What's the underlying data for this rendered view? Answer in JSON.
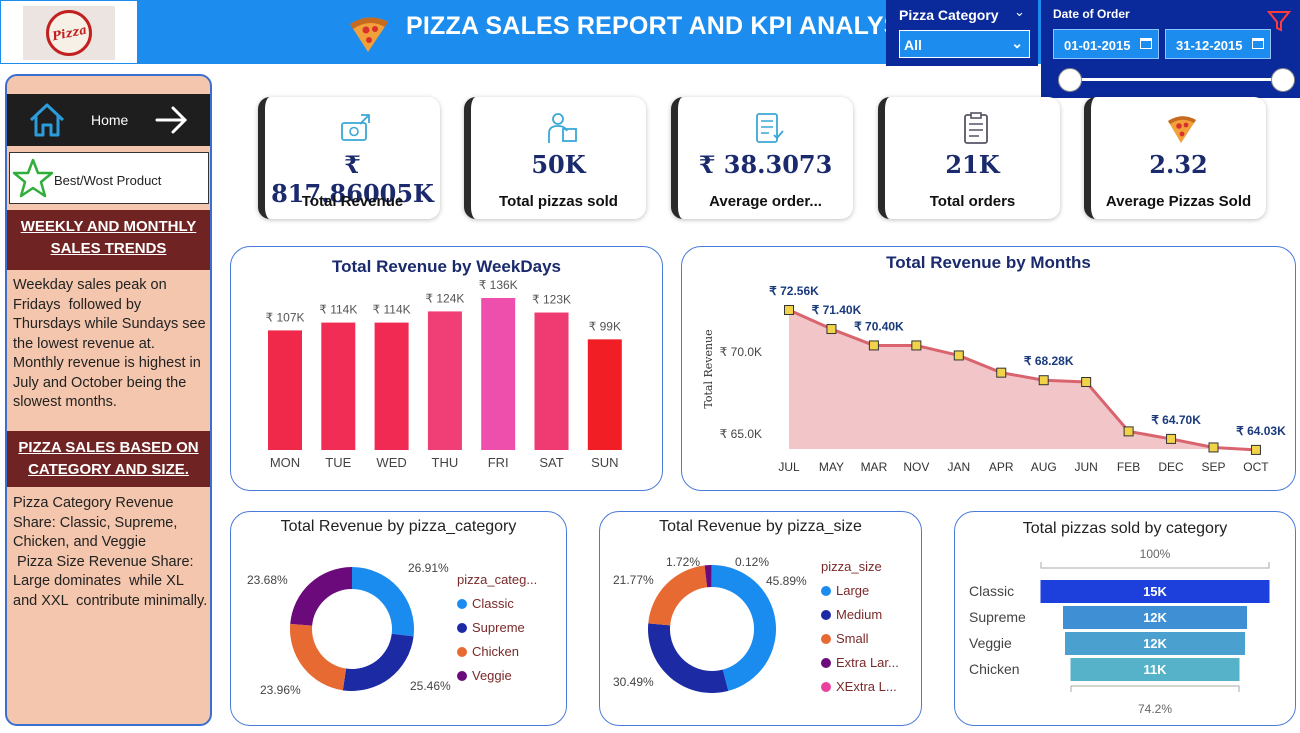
{
  "header": {
    "logo_text": "Pizza",
    "title": "PIZZA SALES REPORT AND KPI ANALYSIS",
    "category_filter": {
      "label": "Pizza Category",
      "value": "All"
    },
    "date_filter": {
      "label": "Date of Order",
      "start": "01-01-2015",
      "end": "31-12-2015"
    }
  },
  "sidebar": {
    "home_label": "Home",
    "best_label": "Best/Wost Product",
    "section1_title": "WEEKLY AND MONTHLY SALES TRENDS",
    "section1_text": "Weekday sales peak on Fridays  followed by Thursdays while Sundays see the lowest revenue at.  Monthly revenue is highest in July and October being the slowest months.",
    "section2_title": "PIZZA SALES BASED ON CATEGORY AND SIZE.",
    "section2_text": "Pizza Category Revenue Share: Classic, Supreme, Chicken, and Veggie\n Pizza Size Revenue Share: Large dominates  while XL and XXL  contribute minimally."
  },
  "kpis": [
    {
      "value": "₹ 817.86005K",
      "label": "Total Revenue",
      "icon": "money-icon"
    },
    {
      "value": "50K",
      "label": "Total pizzas sold",
      "icon": "delivery-icon"
    },
    {
      "value": "₹ 38.3073",
      "label": "Average order...",
      "icon": "checklist-icon"
    },
    {
      "value": "21K",
      "label": "Total orders",
      "icon": "clipboard-icon"
    },
    {
      "value": "2.32",
      "label": "Average Pizzas Sold",
      "icon": "pizza-icon"
    }
  ],
  "chart_data": [
    {
      "type": "bar",
      "title": "Total Revenue by WeekDays",
      "categories": [
        "MON",
        "TUE",
        "WED",
        "THU",
        "FRI",
        "SAT",
        "SUN"
      ],
      "values": [
        107,
        114,
        114,
        124,
        136,
        123,
        99
      ],
      "data_labels": [
        "₹ 107K",
        "₹ 114K",
        "₹ 114K",
        "₹ 124K",
        "₹ 136K",
        "₹ 123K",
        "₹ 99K"
      ],
      "colors": [
        "#f0284a",
        "#f22d55",
        "#f02a52",
        "#f03e76",
        "#ef4fac",
        "#f03b72",
        "#f21e26"
      ]
    },
    {
      "type": "area",
      "title": "Total Revenue by Months",
      "ylabel": "Total Revenue",
      "ytick_labels": [
        "₹ 65.0K",
        "₹ 70.0K"
      ],
      "categories": [
        "JUL",
        "MAY",
        "MAR",
        "NOV",
        "JAN",
        "APR",
        "AUG",
        "JUN",
        "FEB",
        "DEC",
        "SEP",
        "OCT"
      ],
      "values": [
        72.56,
        71.4,
        70.4,
        70.4,
        69.79,
        68.74,
        68.28,
        68.17,
        65.16,
        64.7,
        64.18,
        64.03
      ],
      "data_labels": [
        "₹ 72.56K",
        "₹ 71.40K",
        "₹ 70.40K",
        "",
        "",
        "",
        "₹ 68.28K",
        "",
        "",
        "₹ 64.70K",
        "",
        "₹ 64.03K"
      ],
      "line_color": "#d9646e",
      "fill_color": "#f2c6c9"
    },
    {
      "type": "pie",
      "title": "Total Revenue by pizza_category",
      "legend_title": "pizza_categ...",
      "categories": [
        "Classic",
        "Supreme",
        "Chicken",
        "Veggie"
      ],
      "values": [
        26.91,
        25.46,
        23.96,
        23.68
      ],
      "data_labels": [
        "26.91%",
        "25.46%",
        "23.96%",
        "23.68%"
      ],
      "colors": [
        "#1a8cf0",
        "#1c2ba4",
        "#e86a33",
        "#6b0a7a"
      ]
    },
    {
      "type": "pie",
      "title": "Total Revenue by pizza_size",
      "legend_title": "pizza_size",
      "categories": [
        "Large",
        "Medium",
        "Small",
        "Extra Lar...",
        "XExtra L..."
      ],
      "values": [
        45.89,
        30.49,
        21.77,
        1.72,
        0.12
      ],
      "data_labels": [
        "45.89%",
        "30.49%",
        "21.77%",
        "1.72%",
        "0.12%"
      ],
      "colors": [
        "#1a8cf0",
        "#1c2ba4",
        "#e86a33",
        "#6b0a7a",
        "#e9409f"
      ]
    },
    {
      "type": "bar",
      "title": "Total pizzas sold by category",
      "top_label": "100%",
      "bottom_label": "74.2%",
      "categories": [
        "Classic",
        "Supreme",
        "Veggie",
        "Chicken"
      ],
      "values": [
        15,
        12,
        12,
        11
      ],
      "data_labels": [
        "15K",
        "12K",
        "12K",
        "11K"
      ],
      "colors": [
        "#1d3fdc",
        "#3f8fd4",
        "#4aa0cf",
        "#56b2c8"
      ]
    }
  ]
}
